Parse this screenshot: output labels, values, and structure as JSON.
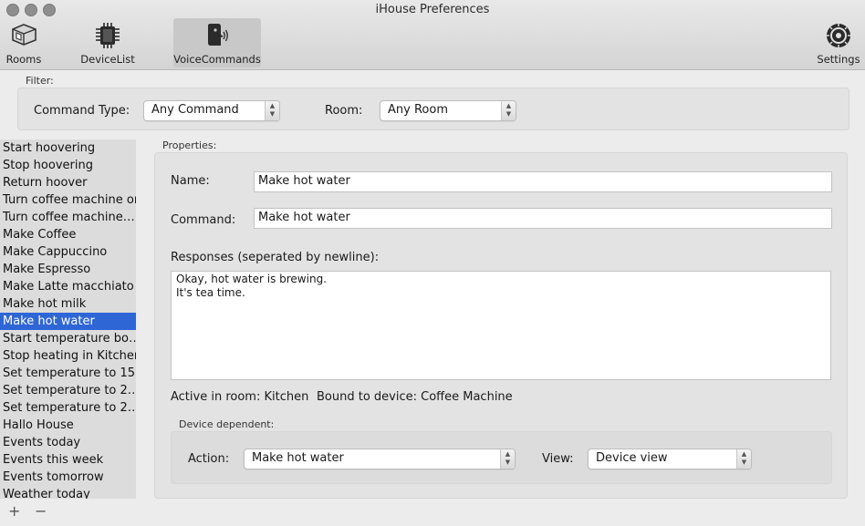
{
  "window": {
    "title": "iHouse Preferences"
  },
  "toolbar": {
    "items": [
      {
        "label": "Rooms",
        "icon": "rooms-icon"
      },
      {
        "label": "DeviceList",
        "icon": "chip-icon"
      },
      {
        "label": "VoiceCommands",
        "icon": "voice-icon"
      },
      {
        "label": "Settings",
        "icon": "gear-icon"
      }
    ]
  },
  "filter": {
    "legend": "Filter:",
    "command_type_label": "Command Type:",
    "command_type_value": "Any Command",
    "room_label": "Room:",
    "room_value": "Any Room"
  },
  "commands": [
    "Start hoovering",
    "Stop hoovering",
    "Return hoover",
    "Turn coffee machine on",
    "Turn coffee machine…",
    "Make Coffee",
    "Make Cappuccino",
    "Make Espresso",
    "Make Latte macchiato",
    "Make hot milk",
    "Make hot water",
    "Start temperature bo…",
    "Stop heating in Kitchen",
    "Set temperature to 15…",
    "Set temperature to 2…",
    "Set temperature to 2…",
    "Hallo House",
    "Events today",
    "Events this week",
    "Events tomorrow",
    "Weather today"
  ],
  "selected_index": 10,
  "properties": {
    "legend": "Properties:",
    "name_label": "Name:",
    "name_value": "Make hot water",
    "command_label": "Command:",
    "command_value": "Make hot water",
    "responses_label": "Responses (seperated by newline):",
    "responses": [
      "Okay, hot water is brewing.",
      "It's tea time."
    ],
    "active_room": "Active in room: Kitchen",
    "bound_device": "Bound to device: Coffee Machine"
  },
  "device_dependent": {
    "legend": "Device dependent:",
    "action_label": "Action:",
    "action_value": "Make hot water",
    "view_label": "View:",
    "view_value": "Device view"
  },
  "list_controls": {
    "add": "+",
    "remove": "−"
  },
  "colors": {
    "selection": "#2f66d5",
    "window_bg": "#ececec"
  }
}
